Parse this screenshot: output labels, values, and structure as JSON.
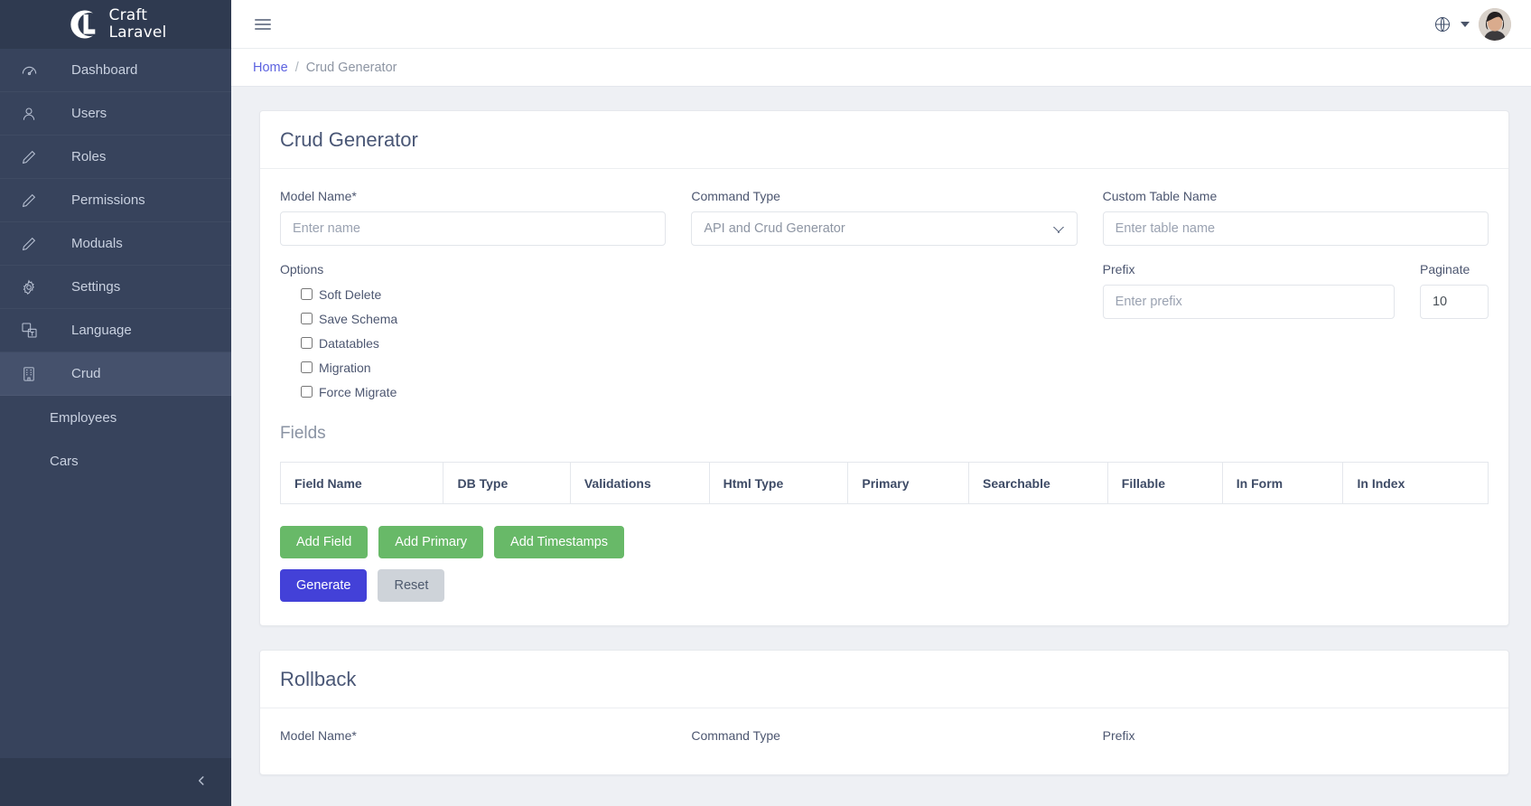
{
  "sidebar": {
    "logo": {
      "line1": "Craft",
      "line2": "Laravel",
      "mark_icon": "craft-laravel-logo"
    },
    "items": [
      {
        "label": "Dashboard",
        "icon": "speedometer-icon",
        "active": false
      },
      {
        "label": "Users",
        "icon": "user-icon",
        "active": false
      },
      {
        "label": "Roles",
        "icon": "pencil-icon",
        "active": false
      },
      {
        "label": "Permissions",
        "icon": "pencil-icon",
        "active": false
      },
      {
        "label": "Moduals",
        "icon": "pencil-icon",
        "active": false
      },
      {
        "label": "Settings",
        "icon": "gear-icon",
        "active": false
      },
      {
        "label": "Language",
        "icon": "translate-icon",
        "active": false
      },
      {
        "label": "Crud",
        "icon": "building-icon",
        "active": true
      }
    ],
    "sub_items": [
      {
        "label": "Employees"
      },
      {
        "label": "Cars"
      }
    ],
    "collapse_icon": "chevron-left-icon"
  },
  "topbar": {
    "menu_icon": "hamburger-icon",
    "language_icon": "globe-icon",
    "language_caret_icon": "caret-down-icon",
    "avatar_icon": "user-avatar"
  },
  "breadcrumb": {
    "home": "Home",
    "separator": "/",
    "current": "Crud Generator"
  },
  "crud_card": {
    "title": "Crud Generator",
    "model_name": {
      "label": "Model Name*",
      "placeholder": "Enter name",
      "value": ""
    },
    "command_type": {
      "label": "Command Type",
      "selected": "API and Crud Generator",
      "options": [
        "API and Crud Generator"
      ]
    },
    "custom_table_name": {
      "label": "Custom Table Name",
      "placeholder": "Enter table name",
      "value": ""
    },
    "options": {
      "label": "Options",
      "items": [
        {
          "label": "Soft Delete",
          "checked": false
        },
        {
          "label": "Save Schema",
          "checked": false
        },
        {
          "label": "Datatables",
          "checked": false
        },
        {
          "label": "Migration",
          "checked": false
        },
        {
          "label": "Force Migrate",
          "checked": false
        }
      ]
    },
    "prefix": {
      "label": "Prefix",
      "placeholder": "Enter prefix",
      "value": ""
    },
    "paginate": {
      "label": "Paginate",
      "value": "10"
    },
    "fields": {
      "title": "Fields",
      "columns": [
        "Field Name",
        "DB Type",
        "Validations",
        "Html Type",
        "Primary",
        "Searchable",
        "Fillable",
        "In Form",
        "In Index"
      ],
      "rows": []
    },
    "buttons": {
      "add_field": "Add Field",
      "add_primary": "Add Primary",
      "add_timestamps": "Add Timestamps",
      "generate": "Generate",
      "reset": "Reset"
    }
  },
  "rollback_card": {
    "title": "Rollback",
    "model_name_label": "Model Name*",
    "command_type_label": "Command Type",
    "prefix_label": "Prefix"
  },
  "colors": {
    "sidebar_bg": "#37435c",
    "sidebar_head_bg": "#2f3a50",
    "sidebar_active_bg": "#45516c",
    "accent_link": "#5c62e0",
    "green_button": "#68b968",
    "indigo_button": "#4341d8",
    "grey_button": "#ced3d9",
    "page_bg": "#eef0f4"
  }
}
